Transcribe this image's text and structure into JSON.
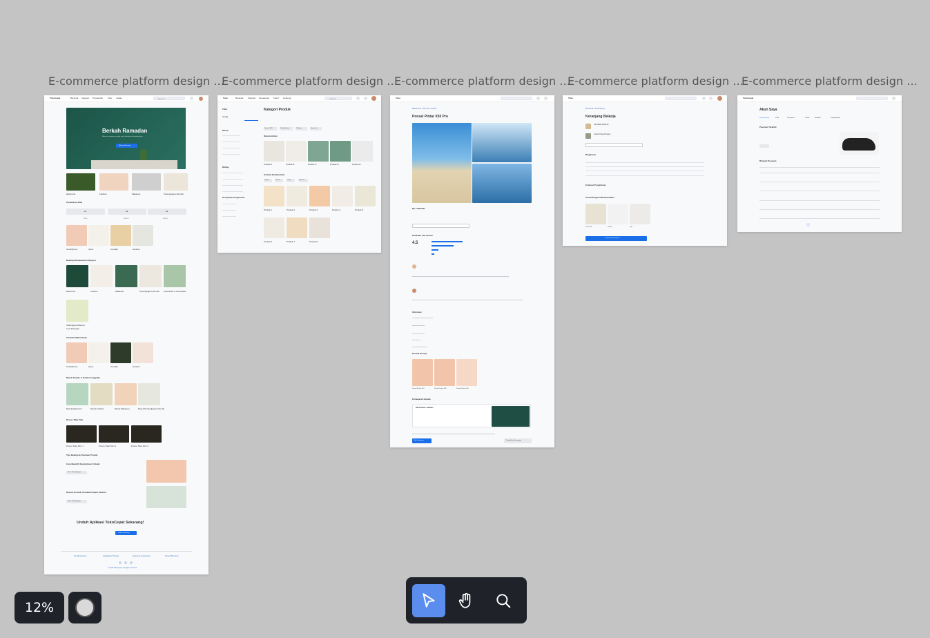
{
  "frames": [
    {
      "title": "E-commerce platform design ..."
    },
    {
      "title": "E-commerce platform design ..."
    },
    {
      "title": "E-commerce platform design ..."
    },
    {
      "title": "E-commerce platform design ..."
    },
    {
      "title": "E-commerce platform design ..."
    }
  ],
  "home": {
    "brand": "TokoCepat",
    "nav": [
      "Beranda",
      "Kategori",
      "Penawaran",
      "Toko",
      "Jualan"
    ],
    "search": "Search",
    "hero_title": "Berkah Ramadan",
    "hero_sub": "Nikmati penawaran spesial untuk kebutuhan Ramadan Anda",
    "hero_cta": "Belanja Sekarang",
    "cats": [
      "Elektronik",
      "Fashion",
      "Makanan",
      "Perlengkapan Rumah"
    ],
    "flash_title": "Penawaran Kilat",
    "flash_timer": [
      "23",
      "59",
      "59"
    ],
    "flash_timer_labels": [
      "Jam",
      "Menit",
      "Detik"
    ],
    "flash_items": [
      "Smartphone",
      "Gaun",
      "Cemilan",
      "Handuk"
    ],
    "bycat_title": "Belanja Berdasarkan Kategori",
    "bycat_items": [
      "Elektronik",
      "Fashion",
      "Makanan",
      "Perlengkapan Rumah",
      "Kesehatan & Kecantikan",
      "Olahraga & Hiburan",
      "Luar Ruangan"
    ],
    "viewed_title": "Terakhir Dilihat Anda",
    "viewed_items": [
      "Smartphone",
      "Gaun",
      "Cemilan",
      "Handuk"
    ],
    "brands_title": "Merek Teratas & Koleksi Unggulan",
    "brands_items": [
      "Merek Elektronik",
      "Merek Fashion",
      "Merek Makanan",
      "Merek Perlengkapan Rumah"
    ],
    "promo_title": "Promo Tiket Film",
    "promo_items": [
      "Promo Tiket Film 1",
      "Promo Tiket Film 2",
      "Promo Tiket Film 3"
    ],
    "tips_title": "Tips Belanja & Panduan Produk",
    "tip1_title": "Cara Memilih Smartphone Terbaik",
    "tip1_cta": "Baca Selengkapnya",
    "tip2_title": "Review Produk: Peralatan Dapur Modern",
    "tip2_cta": "Baca Selengkapnya",
    "app_title": "Unduh Aplikasi TokoCepat Sekarang!",
    "app_cta": "Unduh Sekarang",
    "footer_links": [
      "Tentang Kami",
      "Kebijakan Privasi",
      "Syarat & Ketentuan",
      "Pusat Bantuan"
    ],
    "copyright": "© 2025 TokoCepat. All rights reserved."
  },
  "catalog": {
    "brand": "Toko",
    "nav": [
      "Beranda",
      "Kategori",
      "Penawaran",
      "Flash!",
      "Hubungi"
    ],
    "search": "Search",
    "filter_title": "Filter",
    "price_label": "Harga",
    "page_title": "Kategori Produk",
    "chips": [
      "Terbaru 2025",
      "Paling Populer",
      "Clothing",
      "Harga Low"
    ],
    "section1": "Rekomendasi",
    "row1": [
      "Produk A",
      "Produk B",
      "Produk C",
      "Produk D",
      "Produk E"
    ],
    "section2": "Urutkan Berdasarkan",
    "sort_chips": [
      "Terbaik",
      "Terbaru",
      "Harga",
      "Rekomen"
    ],
    "row2": [
      "Produk 1",
      "Produk 2",
      "Produk 3",
      "Produk 4",
      "Produk 5"
    ],
    "row3": [
      "Produk 6",
      "Produk 7",
      "Produk 8"
    ],
    "sidebar_groups": [
      "Merek",
      "Rating",
      "Kecepatan Pengiriman"
    ]
  },
  "product": {
    "brand": "Toko",
    "breadcrumb": "Elektronik / Ponsel / Pintar",
    "title": "Ponsel Pintar X50 Pro",
    "price": "Rp 7.999.000",
    "reviews_title": "Penilaian dan Ulasan",
    "rating": "4.5",
    "spec_title": "Informasi",
    "related_title": "Produk Serupa",
    "related": [
      "Ponsel Pintar X10",
      "Ponsel Pintar X40",
      "Ponsel Pintar X30"
    ],
    "bundle_title": "Penawaran Bundle",
    "bundle_item": "Beli Produk + Earbuds",
    "buy": "Beli Sekarang",
    "cart": "Tambahkan Keranjang"
  },
  "cart": {
    "brand": "Toko",
    "breadcrumb": "Beranda / Keranjang",
    "title": "Keranjang Belanja",
    "items": [
      "Topi Safari Premium",
      "Celana Kargo Panjang"
    ],
    "summary_title": "Ringkasan",
    "shipping_title": "Estimasi Pengiriman",
    "recommend_title": "Anda Mungkin Membutuhkan",
    "recommend": [
      "Kaos Kaki",
      "Sabuk",
      "Topi"
    ],
    "checkout": "Lanjut ke Pembayaran"
  },
  "account": {
    "brand": "TokoCepat",
    "title": "Akun Saya",
    "tabs": [
      "Pesanan Saya",
      "Profil",
      "Pengaturan",
      "Ulasan",
      "Notifikasi",
      "Pengembalian"
    ],
    "last_order": "Pesanan Terakhir",
    "history": "Riwayat Pesanan"
  },
  "controls": {
    "zoom": "12%",
    "tools": [
      "select-tool",
      "hand-tool",
      "zoom-tool"
    ]
  },
  "colors": {
    "canvas": "#c4c4c4",
    "accent": "#1a6fe8",
    "toolbar": "#1f2329",
    "active_tool": "#5b8def",
    "hero": "#1f5a4e"
  }
}
